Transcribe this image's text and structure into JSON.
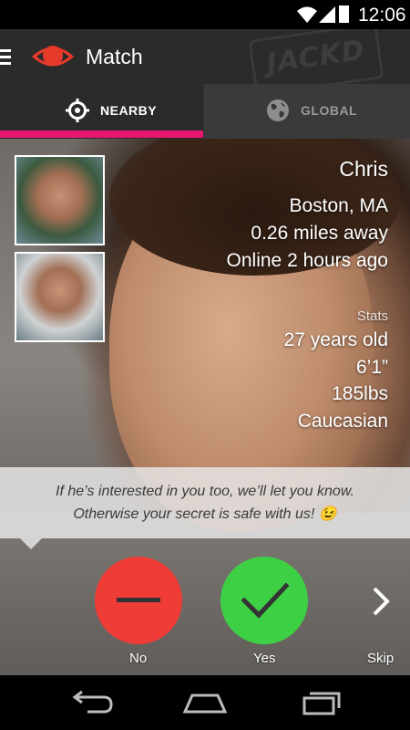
{
  "status_bar": {
    "time": "12:06"
  },
  "app_bar": {
    "title": "Match",
    "watermark": "JACKD"
  },
  "tabs": [
    {
      "label": "NEARBY",
      "icon": "crosshair-icon",
      "active": true
    },
    {
      "label": "GLOBAL",
      "icon": "globe-icon",
      "active": false
    }
  ],
  "profile": {
    "name": "Chris",
    "city": "Boston, MA",
    "distance": "0.26 miles away",
    "last_online": "Online 2 hours ago",
    "stats_label": "Stats",
    "age": "27 years old",
    "height": "6’1”",
    "weight": "185lbs",
    "ethnicity": "Caucasian"
  },
  "banner": {
    "line1": "If he’s interested in you too, we’ll let you know.",
    "line2": "Otherwise your secret is safe with us! 😉"
  },
  "actions": {
    "no_label": "No",
    "yes_label": "Yes",
    "skip_label": "Skip"
  },
  "colors": {
    "accent": "#e8166e",
    "no": "#f03c36",
    "yes": "#3ed044",
    "app_bar": "#2b2b2b"
  }
}
